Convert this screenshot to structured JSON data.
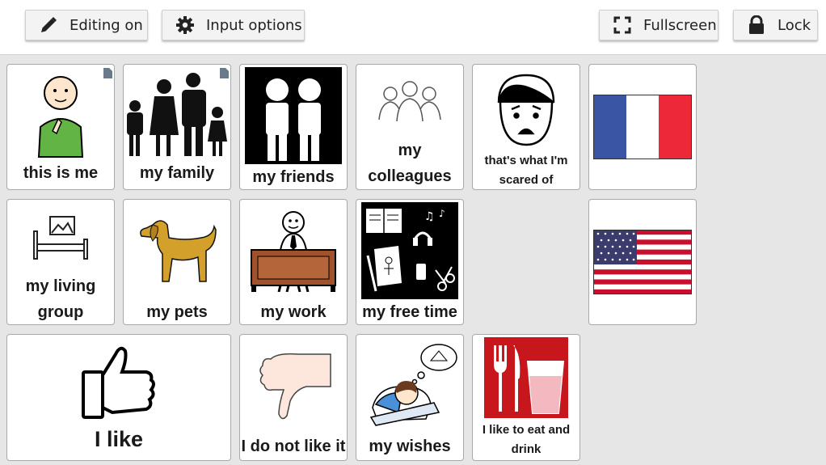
{
  "toolbar": {
    "editing_label": "Editing on",
    "input_label": "Input options",
    "fullscreen_label": "Fullscreen",
    "lock_label": "Lock"
  },
  "cells": {
    "this_is_me": "this is me",
    "my_family": "my family",
    "my_friends": "my friends",
    "my_colleagues": "my colleagues",
    "scared_of": "that's what I'm scared of",
    "my_living_group": "my living group",
    "my_pets": "my pets",
    "my_work": "my work",
    "my_free_time": "my free time",
    "i_like": "I like",
    "i_do_not_like": "I do not like it",
    "my_wishes": "my wishes",
    "eat_drink": "I like to eat and drink"
  },
  "colors": {
    "flag_blue": "#3a55a4",
    "flag_red": "#ed2939",
    "food_red": "#c8161d",
    "dog": "#d4a02c",
    "desk": "#a0522d",
    "shirt": "#62b545"
  },
  "icons": [
    "pencil-icon",
    "gear-icon",
    "fullscreen-icon",
    "lock-icon",
    "folder-corner-icon"
  ]
}
